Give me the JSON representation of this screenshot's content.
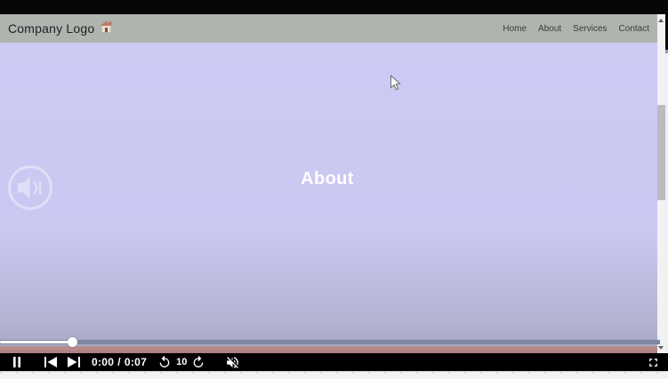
{
  "webpage": {
    "navbar": {
      "brand": "Company Logo",
      "brand_icon": "house-icon",
      "background_color": "#aeb4ae",
      "links": [
        {
          "label": "Home"
        },
        {
          "label": "About"
        },
        {
          "label": "Services"
        },
        {
          "label": "Contact"
        }
      ]
    },
    "content": {
      "heading": "About",
      "background_color": "#cac7f1",
      "overlay_icon": "speaker-audio-icon"
    },
    "footer_strip_color": "#b28384",
    "scrollbar": {
      "track_color": "#f1f2f4",
      "thumb_color": "#b9bbbe"
    }
  },
  "player": {
    "seek": {
      "progress_percent": 11,
      "track_color": "#7d87a3",
      "fill_color": "#ffffff"
    },
    "controls": {
      "bar_color": "#000000",
      "pause_icon": "pause-icon",
      "prev_icon": "skip-previous-icon",
      "next_icon": "skip-next-icon",
      "time_current": "0:00",
      "time_separator": "/",
      "time_duration": "0:07",
      "rewind_icon": "rotate-left-icon",
      "skip_seconds": "10",
      "forward_icon": "rotate-right-icon",
      "mute_icon": "volume-muted-icon",
      "fullscreen_icon": "fullscreen-icon"
    }
  }
}
